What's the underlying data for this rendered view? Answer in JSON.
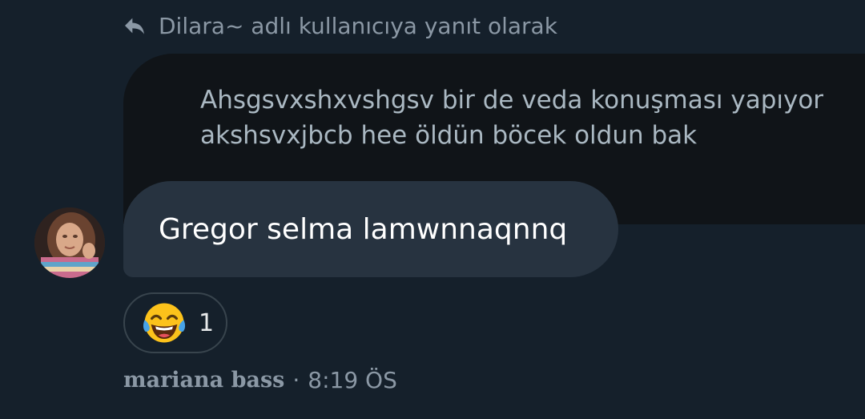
{
  "reply": {
    "label": "Dilara~ adlı kullanıcıya yanıt olarak",
    "icon": "reply-arrow-icon"
  },
  "quoted_message": {
    "text": "Ahsgsvxshxvshgsv bir de veda konuşması yapıyor\nakshsvxjbcb hee öldün böcek oldun bak"
  },
  "message": {
    "text": "Gregor selma lamwnnaqnnq",
    "avatar": "user-avatar-photo"
  },
  "reaction": {
    "emoji": "😂",
    "count": "1"
  },
  "meta": {
    "sender": "mariana bass",
    "separator": "·",
    "time": "8:19 ÖS"
  },
  "colors": {
    "background": "#15202b",
    "bubble": "#273340",
    "quoted_bubble": "#101418",
    "muted_text": "#8b98a5"
  }
}
